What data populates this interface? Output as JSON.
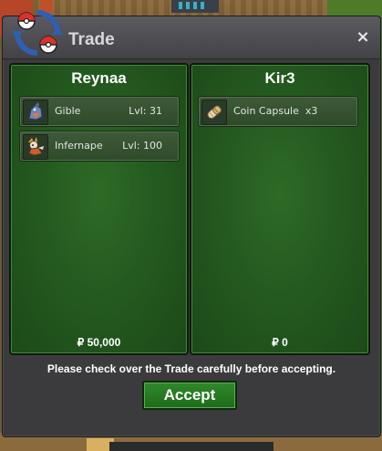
{
  "window": {
    "title": "Trade",
    "close_label": "×"
  },
  "colors": {
    "panel_green": "#245a1f",
    "accept_green": "#2f8a2a",
    "window_gray": "#3b3b3e"
  },
  "left_panel": {
    "player": "Reynaa",
    "items": [
      {
        "name": "Gible",
        "level": "Lvl: 31",
        "icon": "gible-sprite-icon"
      },
      {
        "name": "Infernape",
        "level": "Lvl: 100",
        "icon": "infernape-sprite-icon"
      }
    ],
    "money": "₽ 50,000"
  },
  "right_panel": {
    "player": "Kir3",
    "items": [
      {
        "name": "Coin Capsule  x3",
        "icon": "coin-capsule-icon"
      }
    ],
    "money": "₽ 0"
  },
  "notice": "Please check over the Trade carefully before accepting.",
  "accept_label": "Accept"
}
